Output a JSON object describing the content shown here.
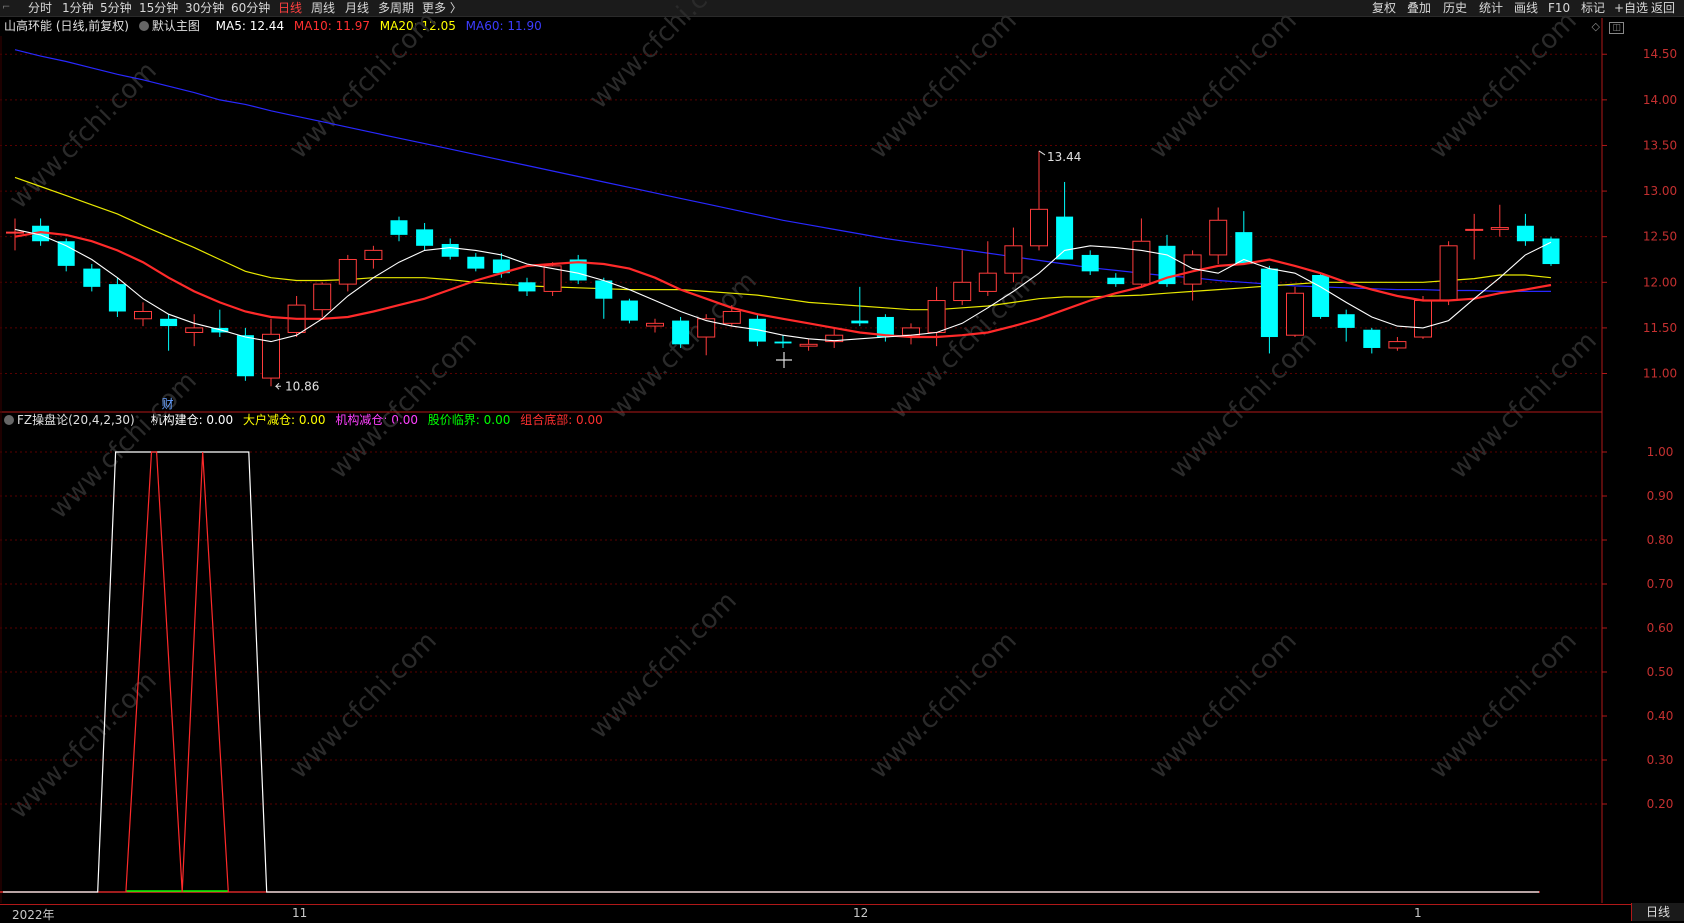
{
  "toolbar": {
    "periods": [
      "分时",
      "1分钟",
      "5分钟",
      "15分钟",
      "30分钟",
      "60分钟",
      "日线",
      "周线",
      "月线",
      "多周期",
      "更多 〉"
    ],
    "active": "日线",
    "right_buttons": [
      "复权",
      "叠加",
      "历史",
      "统计",
      "画线",
      "F10",
      "标记",
      "+自选",
      "返回"
    ]
  },
  "main_header": {
    "stock": "山高环能 (日线,前复权)",
    "template": "默认主图",
    "ma5": "MA5: 12.44",
    "ma10": "MA10: 11.97",
    "ma20": "MA20: 12.05",
    "ma60": "MA60: 11.90"
  },
  "indicator_header": {
    "name": "FZ操盘论(20,4,2,30)",
    "s1": "机构建仓: 0.00",
    "s2": "大户减仓: 0.00",
    "s3": "机构减仓: 0.00",
    "s4": "股价临界: 0.00",
    "s5": "组合底部: 0.00"
  },
  "annotations": {
    "high": "13.44",
    "low": "10.86",
    "marker": "财"
  },
  "price_axis": [
    "14.50",
    "14.00",
    "13.50",
    "13.00",
    "12.50",
    "12.00",
    "11.50",
    "11.00"
  ],
  "indicator_axis": [
    "1.00",
    "0.90",
    "0.80",
    "0.70",
    "0.60",
    "0.50",
    "0.40",
    "0.30",
    "0.20"
  ],
  "date_labels": [
    "2022年",
    "11",
    "12",
    "1"
  ],
  "period_tab": "日线",
  "watermark": "www.cfchi.com",
  "colors": {
    "up": "#ff3c3c",
    "down": "#00ffff",
    "ma5": "#ffffff",
    "ma10": "#ff2a2a",
    "ma20": "#e8e800",
    "ma60": "#2828ff",
    "grid": "#5a0000",
    "axis": "#b01818"
  },
  "chart_data": {
    "type": "candlestick",
    "ylim": [
      10.6,
      14.7
    ],
    "candles": [
      {
        "o": 12.55,
        "h": 12.7,
        "l": 12.35,
        "c": 12.55
      },
      {
        "o": 12.62,
        "h": 12.7,
        "l": 12.4,
        "c": 12.45
      },
      {
        "o": 12.45,
        "h": 12.48,
        "l": 12.12,
        "c": 12.18
      },
      {
        "o": 12.15,
        "h": 12.2,
        "l": 11.9,
        "c": 11.95
      },
      {
        "o": 11.98,
        "h": 12.05,
        "l": 11.62,
        "c": 11.68
      },
      {
        "o": 11.6,
        "h": 11.78,
        "l": 11.52,
        "c": 11.68
      },
      {
        "o": 11.6,
        "h": 11.65,
        "l": 11.25,
        "c": 11.52
      },
      {
        "o": 11.45,
        "h": 11.65,
        "l": 11.3,
        "c": 11.5
      },
      {
        "o": 11.5,
        "h": 11.7,
        "l": 11.4,
        "c": 11.45
      },
      {
        "o": 11.42,
        "h": 11.5,
        "l": 10.92,
        "c": 10.97
      },
      {
        "o": 10.95,
        "h": 11.6,
        "l": 10.86,
        "c": 11.43
      },
      {
        "o": 11.45,
        "h": 11.85,
        "l": 11.4,
        "c": 11.75
      },
      {
        "o": 11.7,
        "h": 12.0,
        "l": 11.62,
        "c": 11.98
      },
      {
        "o": 11.98,
        "h": 12.3,
        "l": 11.9,
        "c": 12.25
      },
      {
        "o": 12.25,
        "h": 12.4,
        "l": 12.15,
        "c": 12.35
      },
      {
        "o": 12.68,
        "h": 12.72,
        "l": 12.45,
        "c": 12.52
      },
      {
        "o": 12.58,
        "h": 12.65,
        "l": 12.35,
        "c": 12.4
      },
      {
        "o": 12.42,
        "h": 12.48,
        "l": 12.25,
        "c": 12.28
      },
      {
        "o": 12.28,
        "h": 12.32,
        "l": 12.12,
        "c": 12.15
      },
      {
        "o": 12.25,
        "h": 12.32,
        "l": 12.05,
        "c": 12.1
      },
      {
        "o": 12.0,
        "h": 12.05,
        "l": 11.85,
        "c": 11.9
      },
      {
        "o": 11.9,
        "h": 12.22,
        "l": 11.85,
        "c": 12.18
      },
      {
        "o": 12.25,
        "h": 12.3,
        "l": 11.98,
        "c": 12.02
      },
      {
        "o": 12.02,
        "h": 12.05,
        "l": 11.6,
        "c": 11.82
      },
      {
        "o": 11.8,
        "h": 11.82,
        "l": 11.55,
        "c": 11.58
      },
      {
        "o": 11.52,
        "h": 11.6,
        "l": 11.45,
        "c": 11.55
      },
      {
        "o": 11.58,
        "h": 11.62,
        "l": 11.28,
        "c": 11.32
      },
      {
        "o": 11.4,
        "h": 11.65,
        "l": 11.2,
        "c": 11.6
      },
      {
        "o": 11.55,
        "h": 11.75,
        "l": 11.52,
        "c": 11.68
      },
      {
        "o": 11.6,
        "h": 11.65,
        "l": 11.3,
        "c": 11.35
      },
      {
        "o": 11.35,
        "h": 11.42,
        "l": 11.28,
        "c": 11.33
      },
      {
        "o": 11.3,
        "h": 11.38,
        "l": 11.25,
        "c": 11.32
      },
      {
        "o": 11.35,
        "h": 11.5,
        "l": 11.28,
        "c": 11.42
      },
      {
        "o": 11.58,
        "h": 11.95,
        "l": 11.52,
        "c": 11.55
      },
      {
        "o": 11.62,
        "h": 11.65,
        "l": 11.35,
        "c": 11.4
      },
      {
        "o": 11.42,
        "h": 11.55,
        "l": 11.32,
        "c": 11.5
      },
      {
        "o": 11.45,
        "h": 11.95,
        "l": 11.3,
        "c": 11.8
      },
      {
        "o": 11.8,
        "h": 12.35,
        "l": 11.75,
        "c": 12.0
      },
      {
        "o": 11.9,
        "h": 12.45,
        "l": 11.85,
        "c": 12.1
      },
      {
        "o": 12.1,
        "h": 12.6,
        "l": 12.0,
        "c": 12.4
      },
      {
        "o": 12.4,
        "h": 13.44,
        "l": 12.35,
        "c": 12.8
      },
      {
        "o": 12.72,
        "h": 13.1,
        "l": 12.25,
        "c": 12.25
      },
      {
        "o": 12.3,
        "h": 12.35,
        "l": 12.08,
        "c": 12.12
      },
      {
        "o": 12.05,
        "h": 12.1,
        "l": 11.95,
        "c": 11.98
      },
      {
        "o": 11.98,
        "h": 12.7,
        "l": 11.95,
        "c": 12.45
      },
      {
        "o": 12.4,
        "h": 12.52,
        "l": 11.95,
        "c": 11.98
      },
      {
        "o": 11.98,
        "h": 12.35,
        "l": 11.8,
        "c": 12.3
      },
      {
        "o": 12.3,
        "h": 12.82,
        "l": 12.2,
        "c": 12.68
      },
      {
        "o": 12.55,
        "h": 12.78,
        "l": 12.2,
        "c": 12.2
      },
      {
        "o": 12.15,
        "h": 12.18,
        "l": 11.22,
        "c": 11.4
      },
      {
        "o": 11.42,
        "h": 11.95,
        "l": 11.4,
        "c": 11.88
      },
      {
        "o": 12.08,
        "h": 12.1,
        "l": 11.6,
        "c": 11.62
      },
      {
        "o": 11.65,
        "h": 11.7,
        "l": 11.35,
        "c": 11.5
      },
      {
        "o": 11.48,
        "h": 11.5,
        "l": 11.22,
        "c": 11.28
      },
      {
        "o": 11.28,
        "h": 11.4,
        "l": 11.25,
        "c": 11.35
      },
      {
        "o": 11.4,
        "h": 11.85,
        "l": 11.38,
        "c": 11.8
      },
      {
        "o": 11.8,
        "h": 12.45,
        "l": 11.75,
        "c": 12.4
      },
      {
        "o": 12.58,
        "h": 12.75,
        "l": 12.25,
        "c": 12.58
      },
      {
        "o": 12.58,
        "h": 12.85,
        "l": 12.5,
        "c": 12.6
      },
      {
        "o": 12.62,
        "h": 12.75,
        "l": 12.4,
        "c": 12.45
      },
      {
        "o": 12.48,
        "h": 12.5,
        "l": 12.18,
        "c": 12.2
      }
    ],
    "ma5": [
      12.58,
      12.52,
      12.4,
      12.25,
      12.05,
      11.82,
      11.65,
      11.55,
      11.48,
      11.4,
      11.35,
      11.42,
      11.6,
      11.85,
      12.05,
      12.22,
      12.35,
      12.38,
      12.35,
      12.3,
      12.2,
      12.15,
      12.1,
      12.02,
      11.92,
      11.8,
      11.68,
      11.58,
      11.52,
      11.48,
      11.42,
      11.38,
      11.36,
      11.38,
      11.4,
      11.42,
      11.45,
      11.55,
      11.72,
      11.9,
      12.1,
      12.35,
      12.4,
      12.38,
      12.35,
      12.3,
      12.15,
      12.1,
      12.25,
      12.15,
      12.1,
      11.95,
      11.78,
      11.62,
      11.52,
      11.5,
      11.58,
      11.82,
      12.05,
      12.3,
      12.44
    ],
    "ma10": [
      12.5,
      12.55,
      12.52,
      12.45,
      12.35,
      12.22,
      12.05,
      11.9,
      11.78,
      11.68,
      11.62,
      11.6,
      11.6,
      11.62,
      11.68,
      11.75,
      11.82,
      11.92,
      12.02,
      12.1,
      12.18,
      12.2,
      12.22,
      12.2,
      12.15,
      12.05,
      11.92,
      11.82,
      11.72,
      11.65,
      11.6,
      11.55,
      11.5,
      11.45,
      11.42,
      11.4,
      11.4,
      11.42,
      11.45,
      11.52,
      11.6,
      11.7,
      11.8,
      11.88,
      11.95,
      12.05,
      12.12,
      12.18,
      12.2,
      12.25,
      12.18,
      12.1,
      12.0,
      11.92,
      11.85,
      11.8,
      11.8,
      11.82,
      11.88,
      11.92,
      11.97
    ],
    "ma20": [
      13.15,
      13.05,
      12.95,
      12.85,
      12.75,
      12.62,
      12.5,
      12.38,
      12.25,
      12.12,
      12.05,
      12.02,
      12.02,
      12.03,
      12.05,
      12.05,
      12.05,
      12.03,
      12.0,
      11.98,
      11.96,
      11.95,
      11.94,
      11.93,
      11.92,
      11.92,
      11.92,
      11.9,
      11.88,
      11.86,
      11.82,
      11.78,
      11.76,
      11.74,
      11.72,
      11.7,
      11.7,
      11.72,
      11.74,
      11.78,
      11.82,
      11.84,
      11.84,
      11.85,
      11.86,
      11.88,
      11.9,
      11.92,
      11.94,
      11.96,
      11.98,
      12.0,
      12.0,
      12.0,
      12.0,
      12.0,
      12.02,
      12.04,
      12.08,
      12.08,
      12.05
    ],
    "ma60": [
      14.55,
      14.48,
      14.42,
      14.35,
      14.28,
      14.22,
      14.15,
      14.08,
      14.0,
      13.95,
      13.88,
      13.82,
      13.76,
      13.7,
      13.64,
      13.58,
      13.52,
      13.46,
      13.4,
      13.34,
      13.28,
      13.22,
      13.16,
      13.1,
      13.04,
      12.98,
      12.92,
      12.86,
      12.8,
      12.74,
      12.68,
      12.63,
      12.58,
      12.53,
      12.48,
      12.44,
      12.4,
      12.36,
      12.32,
      12.28,
      12.24,
      12.2,
      12.16,
      12.13,
      12.1,
      12.07,
      12.05,
      12.02,
      12.0,
      11.98,
      11.96,
      11.95,
      11.94,
      11.93,
      11.92,
      11.92,
      11.91,
      11.91,
      11.9,
      11.9,
      11.9
    ],
    "indicator": {
      "ylim": [
        0,
        1.05
      ],
      "white_x": [
        0,
        8.2,
        8.2,
        10.3,
        10.3,
        99
      ],
      "white": [
        0,
        0,
        1,
        1,
        0,
        0
      ],
      "red_x": [
        4.8,
        5.8,
        6.0,
        7.0,
        7.8,
        8.8
      ],
      "red": [
        0,
        1,
        1,
        0,
        1,
        0
      ]
    }
  }
}
